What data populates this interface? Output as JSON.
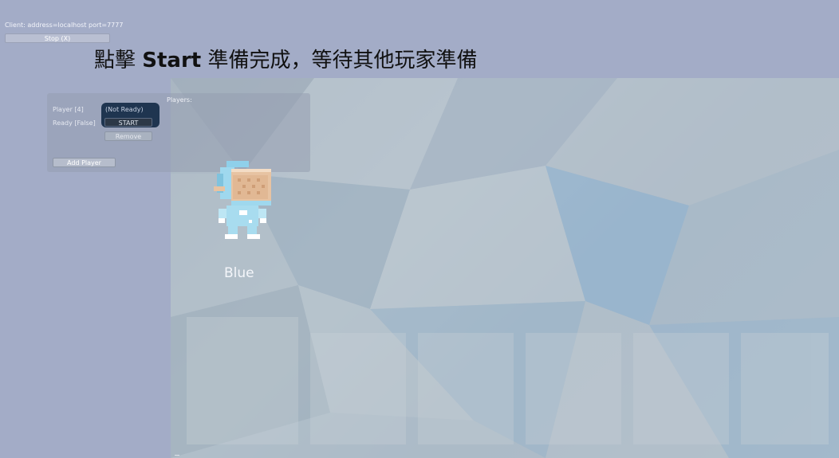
{
  "client": {
    "info": "Client: address=localhost port=7777"
  },
  "toolbar": {
    "stop_label": "Stop (X)"
  },
  "caption": {
    "text_prefix": "點擊 ",
    "text_bold": "Start",
    "text_suffix": " 準備完成，等待其他玩家準備"
  },
  "lobby": {
    "players_label": "Players:",
    "player_slot": "Player [4]",
    "ready_slot": "Ready [False]",
    "ready_status": "(Not Ready)",
    "start_label": "START",
    "remove_label": "Remove",
    "add_player_label": "Add Player"
  },
  "player": {
    "name": "Blue",
    "sprite_icon": "astronaut-character-icon"
  },
  "colors": {
    "background": "#a3acc7",
    "ready_box": "#1f3550",
    "caption_text": "#111111",
    "player_suit": "#a8dcef",
    "player_visor": "#e7c3a2"
  }
}
